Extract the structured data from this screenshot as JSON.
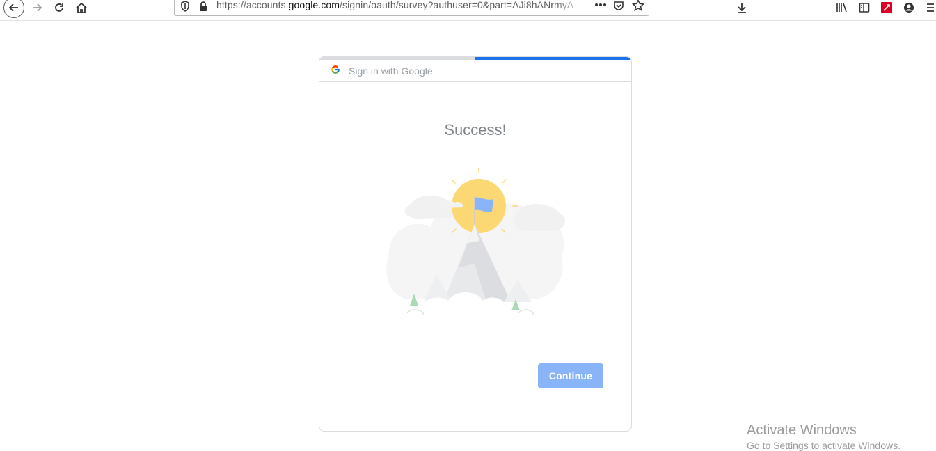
{
  "browser": {
    "url_prefix": "https://accounts.",
    "url_domain": "google.com",
    "url_suffix": "/signin/oauth/survey?authuser=0&part=AJi8hANrmyA"
  },
  "card": {
    "header": "Sign in with Google",
    "title": "Success!",
    "progress": 0.5,
    "continue_label": "Continue"
  },
  "watermark": {
    "title": "Activate Windows",
    "subtitle": "Go to Settings to activate Windows."
  },
  "colors": {
    "accent": "#1a73e8",
    "button": "#8ab4f8",
    "sun": "#fcd874",
    "flag": "#8ab4f8"
  }
}
